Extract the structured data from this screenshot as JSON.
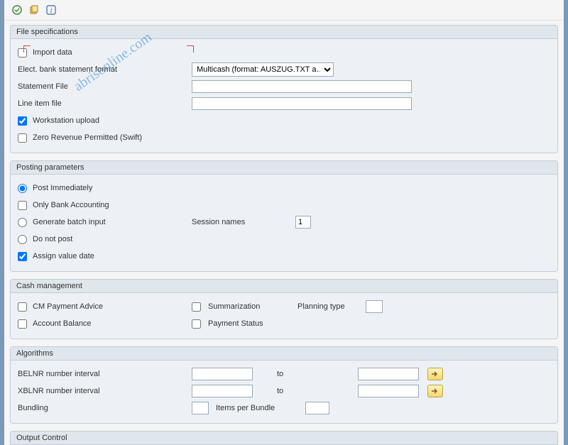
{
  "toolbar": {
    "icons": [
      "execute-icon",
      "variant-icon",
      "info-icon"
    ]
  },
  "groups": {
    "file_spec": {
      "title": "File specifications",
      "import_data_label": "Import data",
      "import_data_checked": false,
      "format_label": "Elect. bank statement format",
      "format_selected": "Multicash (format: AUSZUG.TXT a…",
      "stmt_file_label": "Statement File",
      "stmt_file_value": "",
      "line_item_label": "Line item file",
      "line_item_value": "",
      "ws_upload_label": "Workstation upload",
      "ws_upload_checked": true,
      "zero_rev_label": "Zero Revenue Permitted (Swift)",
      "zero_rev_checked": false
    },
    "posting": {
      "title": "Posting parameters",
      "post_imm_label": "Post Immediately",
      "only_bank_label": "Only Bank Accounting",
      "gen_batch_label": "Generate batch input",
      "session_label": "Session names",
      "session_value": "1",
      "do_not_post_label": "Do not post",
      "assign_vd_label": "Assign value date",
      "assign_vd_checked": true,
      "radio_selected": "post_imm"
    },
    "cash": {
      "title": "Cash management",
      "cm_advice_label": "CM Payment Advice",
      "summarization_label": "Summarization",
      "planning_type_label": "Planning type",
      "planning_type_value": "",
      "acct_balance_label": "Account Balance",
      "payment_status_label": "Payment Status"
    },
    "algo": {
      "title": "Algorithms",
      "belnr_label": "BELNR number interval",
      "xblnr_label": "XBLNR number interval",
      "to_label": "to",
      "bundling_label": "Bundling",
      "items_per_bundle_label": "Items per Bundle"
    },
    "output": {
      "title": "Output Control"
    }
  },
  "watermark": "abrisonline.com"
}
